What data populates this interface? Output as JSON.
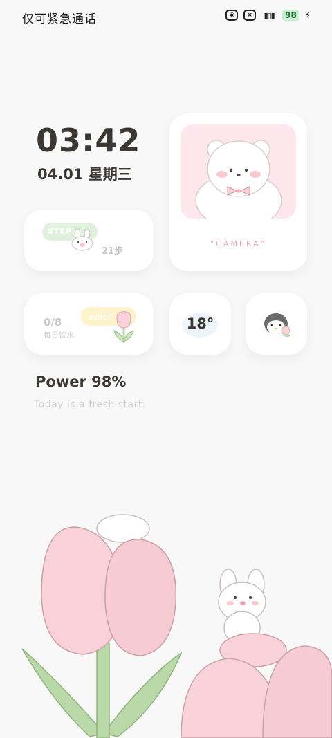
{
  "status_bar": {
    "carrier_text": "仅可紧急通话",
    "icons": [
      "nfc-icon",
      "mute-icon",
      "vibrate-icon"
    ],
    "battery_level": "98",
    "charging": true
  },
  "clock": {
    "time": "03:42",
    "date": "04.01 星期三"
  },
  "widgets": {
    "camera": {
      "label": "\"CAMERA\""
    },
    "steps": {
      "pill_label": "STEP",
      "count": "21步"
    },
    "water": {
      "pill_label": "water",
      "count": "0/8",
      "label": "每日饮水"
    },
    "weather": {
      "temperature": "18°"
    }
  },
  "power": {
    "text": "Power 98%"
  },
  "tagline": "Today is a fresh start.",
  "colors": {
    "background": "#f8f8f8",
    "card": "#ffffff",
    "step_pill": "#dff1dc",
    "water_pill": "#fff3cc",
    "camera_bg": "#fde6ec",
    "tulip_pink": "#f9d2d9",
    "leaf_green": "#b9d9a8"
  }
}
